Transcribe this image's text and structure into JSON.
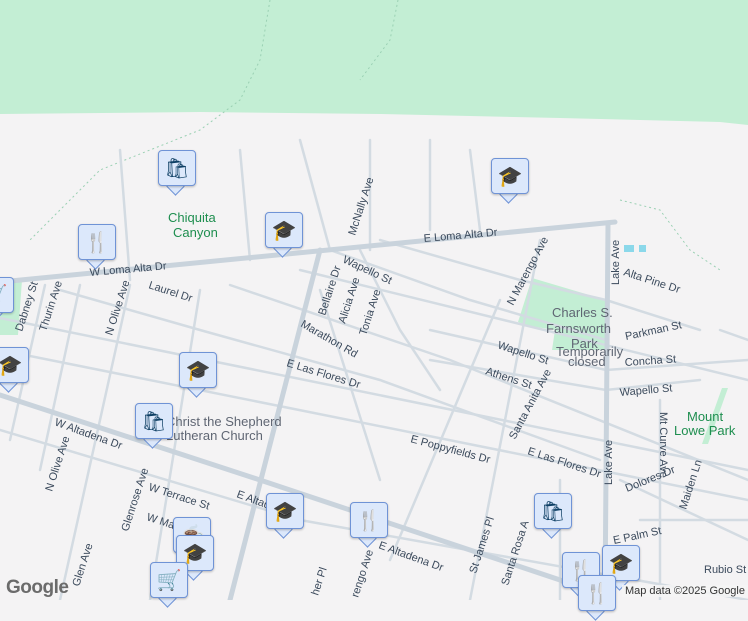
{
  "streets": {
    "w_loma_alta": "W Loma Alta Dr",
    "e_loma_alta": "E Loma Alta Dr",
    "mcnally": "McNally Ave",
    "wapello1": "Wapello St",
    "wapello2": "Wapello St",
    "wapello3": "Wapello St",
    "bellaire": "Bellaire Dr",
    "alicia": "Alicia Ave",
    "tonia": "Tonia Ave",
    "marathon": "Marathon Rd",
    "laurel": "Laurel Dr",
    "dabney": "Dabney St",
    "thurin": "Thurin Ave",
    "n_olive": "N Olive Ave",
    "n_olive2": "N Olive Ave",
    "glenrose_top": "Glenrose Ave",
    "e_las_flores": "E Las Flores Dr",
    "e_las_flores2": "E Las Flores Dr",
    "n_marengo": "N Marengo Ave",
    "lake": "Lake Ave",
    "lake2": "Lake Ave",
    "alta_pine": "Alta Pine Dr",
    "parkman": "Parkman St",
    "concha": "Concha St",
    "athens": "Athens St",
    "santa_anita": "Santa Anita Ave",
    "w_altadena": "W Altadena Dr",
    "e_altadena": "E Altadena Dr",
    "e_altadena2": "E Altadena Dr",
    "e_poppyfields": "E Poppyfields Dr",
    "dolores": "Dolores Dr",
    "mt_curve": "Mt Curve Ave",
    "maiden": "Maiden Ln",
    "w_terrace": "W Terrace St",
    "w_ma": "W Ma",
    "glenrose": "Glenrose Ave",
    "glen": "Glen Ave",
    "e_palm": "E Palm St",
    "rubio": "Rubio St",
    "st_james": "St James Pl",
    "santa_rosa": "Santa Rosa A",
    "marengo": "rengo Ave",
    "fisher": "her Pl"
  },
  "places": {
    "chiquita1": "Chiquita",
    "chiquita2": "Canyon",
    "farnsworth1": "Charles S.",
    "farnsworth2": "Farnsworth",
    "farnsworth3": "Park",
    "farnsworth_status1": "Temporarily",
    "farnsworth_status2": "closed",
    "mtlowe1": "Mount",
    "mtlowe2": "Lowe Park",
    "church1": "Christ the Shepherd",
    "church2": "Lutheran Church"
  },
  "markers": [
    {
      "type": "shopping",
      "glyph": "🛍"
    },
    {
      "type": "school",
      "glyph": "🎓"
    },
    {
      "type": "school",
      "glyph": "🎓"
    },
    {
      "type": "restaurant",
      "glyph": "🍴"
    },
    {
      "type": "grocery",
      "glyph": "🛒"
    },
    {
      "type": "school",
      "glyph": "🎓"
    },
    {
      "type": "school",
      "glyph": "🎓"
    },
    {
      "type": "shopping",
      "glyph": "🛍"
    },
    {
      "type": "school",
      "glyph": "🎓"
    },
    {
      "type": "restaurant",
      "glyph": "🍴"
    },
    {
      "type": "shopping",
      "glyph": "🛍"
    },
    {
      "type": "cafe",
      "glyph": "☕"
    },
    {
      "type": "school",
      "glyph": "🎓"
    },
    {
      "type": "grocery",
      "glyph": "🛒"
    },
    {
      "type": "restaurant",
      "glyph": "🍴"
    },
    {
      "type": "school",
      "glyph": "🎓"
    },
    {
      "type": "restaurant",
      "glyph": "🍴"
    }
  ],
  "logo": "Google",
  "attribution": "Map data ©2025 Google",
  "colors": {
    "park": "#c3eed4",
    "water": "#8bd8ea",
    "road": "#d3dbe2",
    "marker_bg": "#dce8fb",
    "icon": "#0e3f64"
  }
}
